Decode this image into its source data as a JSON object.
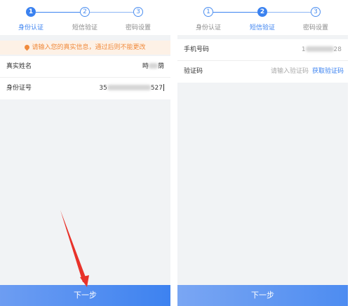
{
  "left_screen": {
    "steps": [
      {
        "number": "1",
        "label": "身份认证",
        "active": true
      },
      {
        "number": "2",
        "label": "短信验证",
        "active": false
      },
      {
        "number": "3",
        "label": "密码设置",
        "active": false
      }
    ],
    "notice": "请输入您的真实信息，通过后则不能更改",
    "fields": [
      {
        "label": "真实姓名",
        "value_prefix": "",
        "value_suffix": "荫"
      },
      {
        "label": "身份证号",
        "value_prefix": "35",
        "value_suffix": "527"
      }
    ],
    "submit_label": "下一步"
  },
  "right_screen": {
    "steps": [
      {
        "number": "1",
        "label": "身份认证",
        "active": false
      },
      {
        "number": "2",
        "label": "短信验证",
        "active": true
      },
      {
        "number": "3",
        "label": "密码设置",
        "active": false
      }
    ],
    "phone": {
      "label": "手机号码",
      "value_prefix": "1",
      "value_suffix": "28"
    },
    "code": {
      "label": "验证码",
      "placeholder": "请输入验证码",
      "button_label": "获取验证码"
    },
    "submit_label": "下一步"
  },
  "colors": {
    "accent": "#3b82f0",
    "notice_text": "#f08a3c",
    "annotation_arrow": "#e8322a"
  }
}
